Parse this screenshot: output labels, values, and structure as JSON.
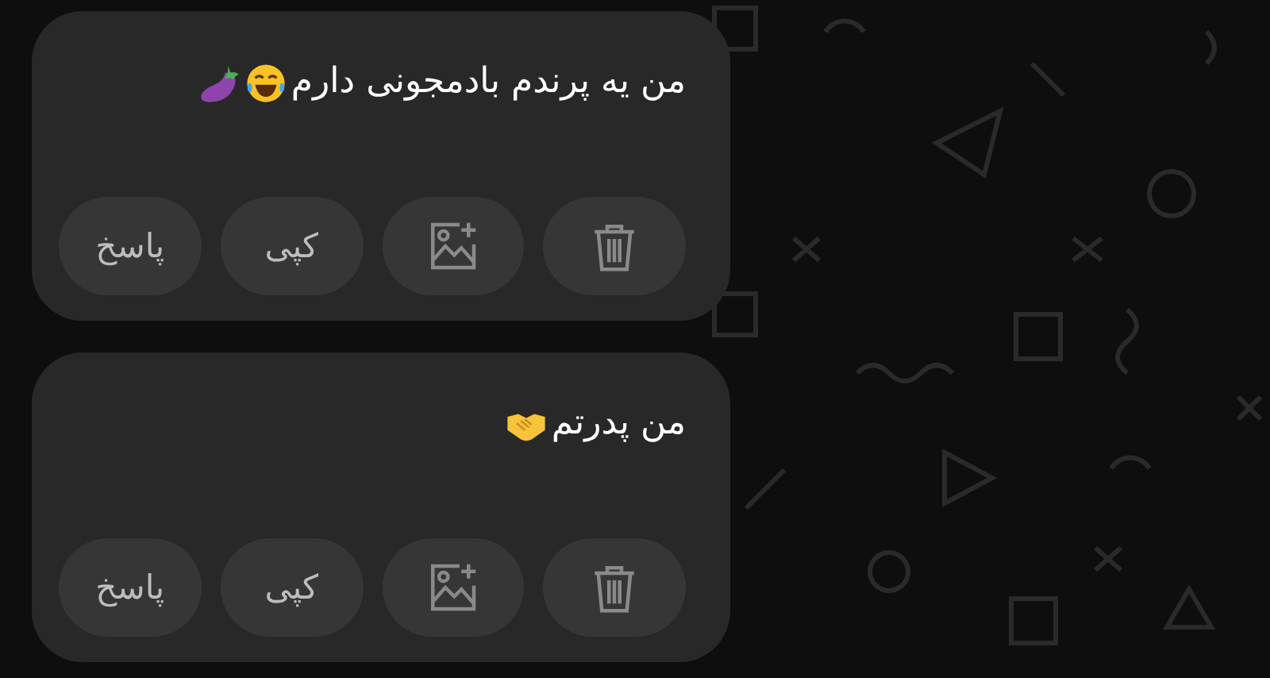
{
  "messages": [
    {
      "text": "من یه پرندم بادمجونی دارم",
      "emojis": [
        {
          "kind": "laughing"
        },
        {
          "kind": "eggplant"
        }
      ],
      "actions": [
        {
          "kind": "delete"
        },
        {
          "kind": "image"
        },
        {
          "kind": "copy",
          "label": "کپی"
        },
        {
          "kind": "reply",
          "label": "پاسخ"
        }
      ]
    },
    {
      "text": "من پدرتم",
      "emojis": [
        {
          "kind": "handshake"
        }
      ],
      "actions": [
        {
          "kind": "delete"
        },
        {
          "kind": "image"
        },
        {
          "kind": "copy",
          "label": "کپی"
        },
        {
          "kind": "reply",
          "label": "پاسخ"
        }
      ]
    }
  ]
}
